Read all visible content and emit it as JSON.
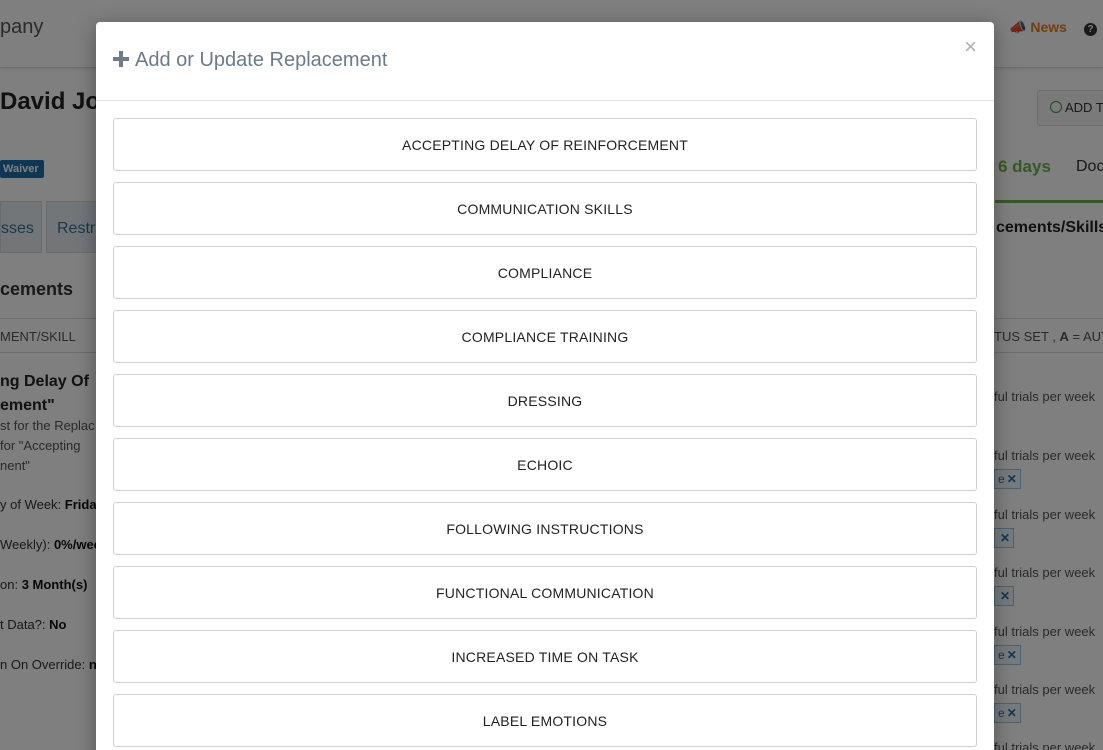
{
  "header": {
    "company": "pany",
    "news_label": "News",
    "help_icon": "question-circle-icon",
    "news_icon": "megaphone-icon"
  },
  "client": {
    "name": "David Jo",
    "add_button_label": "ADD T",
    "waiver_badge": "Waiver",
    "days": "6 days",
    "doc_label": "Doc"
  },
  "tabs": {
    "tab1": "sses",
    "tab2": "Restr",
    "right_tab": "cements/Skills"
  },
  "section": {
    "title": "cements",
    "col_header_left": "MENT/SKILL",
    "col_header_right_prefix": "TUS SET , ",
    "col_header_right_bold": "A",
    "col_header_right_suffix": " = AUT"
  },
  "item": {
    "title_line1": "ng Delay Of",
    "title_line2": "ement\"",
    "desc_line1": "st for the Replac",
    "desc_line2": "for \"Accepting",
    "desc_line3": "nent\"",
    "meta": [
      {
        "label": "y of Week: ",
        "value": "Frida"
      },
      {
        "label": "Weekly): ",
        "value": "0%/wee"
      },
      {
        "label": "on: ",
        "value": "3 Month(s)"
      },
      {
        "label": "t Data?: ",
        "value": "No"
      },
      {
        "label": "n On Override: ",
        "value": "n"
      }
    ]
  },
  "right_column": {
    "trials_text": "ful trials per week",
    "tags": [
      "e",
      "",
      "",
      "e",
      "e"
    ]
  },
  "modal": {
    "title": "Add or Update Replacement",
    "close_symbol": "×",
    "options": [
      "ACCEPTING DELAY OF REINFORCEMENT",
      "COMMUNICATION SKILLS",
      "COMPLIANCE",
      "COMPLIANCE TRAINING",
      "DRESSING",
      "ECHOIC",
      "FOLLOWING INSTRUCTIONS",
      "FUNCTIONAL COMMUNICATION",
      "INCREASED TIME ON TASK",
      "LABEL EMOTIONS"
    ]
  },
  "colors": {
    "overlay": "#000000",
    "accent_green": "#6bb24a",
    "news_orange": "#e67e22",
    "badge_blue": "#1f6fa8"
  }
}
